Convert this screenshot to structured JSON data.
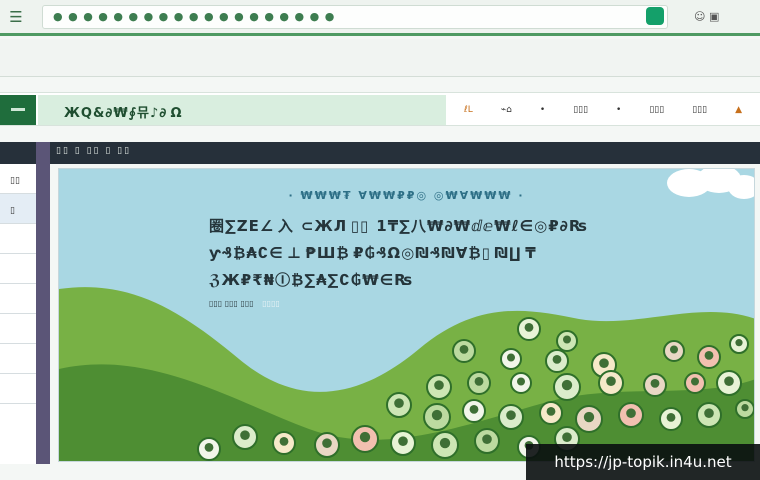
{
  "colors": {
    "brand_green": "#1f6d3c",
    "accent_green": "#14a06a",
    "sky": "#a9d7e3",
    "hill_green": "#6fa83e",
    "dark_bar": "#26303a",
    "rail": "#5b5577"
  },
  "browser": {
    "menu_icon": "☰",
    "address_text": "● ● ● ● ● ● ● ● ● ● ● ● ● ● ● ● ● ● ●",
    "right_icons": "☺ ▣"
  },
  "nav": {
    "brand": "ЖQ&∂₩∮뮤♪∂ Ω",
    "items": [
      {
        "label": "ℓL",
        "accent": true
      },
      {
        "label": "⌁⌂"
      },
      {
        "label": "•"
      },
      {
        "label": "▯▯▯"
      },
      {
        "label": "•"
      },
      {
        "label": "▯▯▯"
      },
      {
        "label": "▯▯▯"
      },
      {
        "label": "▲"
      }
    ]
  },
  "darkbar": {
    "label": "▯▯ ▯ ▯▯ ▯ ▯▯"
  },
  "sidebar": {
    "items": [
      {
        "label": "▯▯"
      },
      {
        "label": "▯"
      },
      {
        "label": ""
      },
      {
        "label": ""
      },
      {
        "label": ""
      },
      {
        "label": ""
      },
      {
        "label": ""
      },
      {
        "label": ""
      }
    ]
  },
  "hero": {
    "kicker": "· ₩₩₩₮ ∀₩₩₽₽◎ ◎₩∀₩₩₩ ·",
    "title_lines": [
      "圈∑ZE∠ 入  ⊂ЖЛ ▯▯  1₸∑八₩∂₩ⅆⅇ₩ℓ∈◎₽∂₨",
      "ƴ₰₿₳∁∈ ⊥ ₱Ш₿ ₽₲₰Ω◎₪₰₪∀₿▯ ₪∐ ₸",
      "ℨЖ₽₹₦Ⓘ₿∑₳∑∁₲₩∈₨ "
    ],
    "meta": "▯▯▯ ▯▯▯ ▯▯▯",
    "meta_dim": "▯▯▯▯"
  },
  "watermark": "https://jp-topik.in4u.net"
}
